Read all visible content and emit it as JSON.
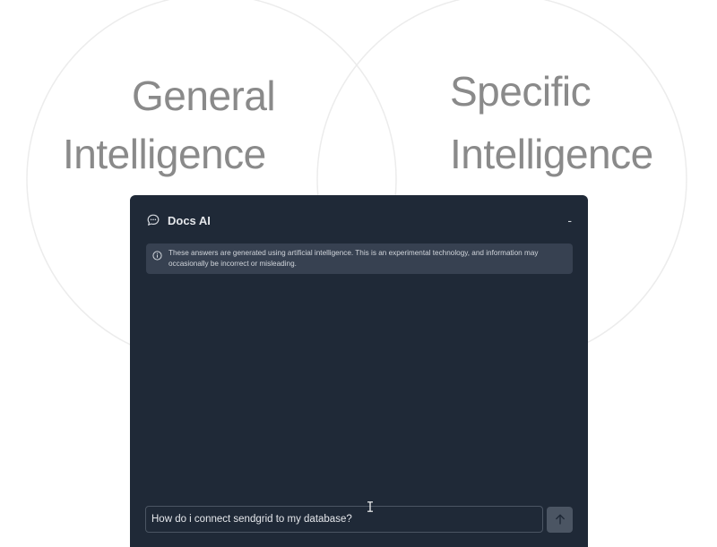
{
  "diagram": {
    "left_circle": {
      "line1": "General",
      "line2": "Intelligence"
    },
    "right_circle": {
      "line1": "Specific",
      "line2": "Intelligence"
    }
  },
  "widget": {
    "title": "Docs AI",
    "minimize_label": "-",
    "chat_icon": "chat-bubble-icon",
    "notice": {
      "icon": "info-icon",
      "text": "These answers are generated using artificial intelligence. This is an experimental technology, and information may occasionally be incorrect or misleading."
    },
    "input": {
      "value": "How do i connect sendgrid to my database?"
    },
    "send_icon": "arrow-up-icon"
  },
  "colors": {
    "panel_bg": "#1f2937",
    "notice_bg": "#374151",
    "venn_text": "#8a8a8a"
  }
}
